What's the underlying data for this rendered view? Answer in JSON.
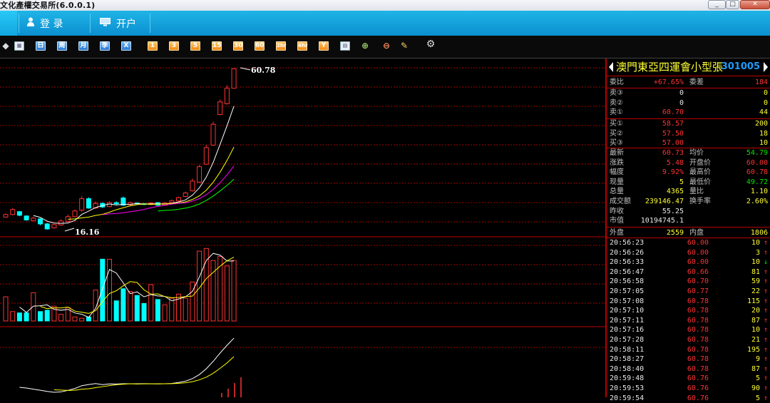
{
  "window": {
    "title": "文化產權交易所(6.0.0.1)",
    "min": "_",
    "max": "□",
    "close": "✕"
  },
  "menu": {
    "login": "登 录",
    "open_account": "开户"
  },
  "toolbar": {
    "period_buttons": [
      "日",
      "周",
      "月",
      "季",
      "X"
    ],
    "minute_buttons": [
      "1",
      "3",
      "5",
      "15",
      "30",
      "60",
      "2hr",
      "4hr",
      "Y"
    ],
    "icons": [
      "chart-type-icon",
      "calendar-icon",
      "draw-icon",
      "zoom-in-icon",
      "zoom-out-icon",
      "edit-icon",
      "gear-icon"
    ]
  },
  "chart": {
    "price_high_label": "60.78",
    "price_low_label": "16.16",
    "colors": {
      "up": "#ff3232",
      "down": "#00ffff",
      "ma5": "#ffffff",
      "ma10": "#ffff00",
      "ma20": "#ff00ff",
      "ma60": "#00ff00",
      "grid": "#a00000"
    }
  },
  "chart_data": {
    "type": "candlestick",
    "candles": [
      [
        19.5,
        20.2,
        20.5,
        19.3
      ],
      [
        20.2,
        21.6,
        22.0,
        20.0
      ],
      [
        21.0,
        20.0,
        21.2,
        19.7
      ],
      [
        19.8,
        18.7,
        20.0,
        18.5
      ],
      [
        18.5,
        19.2,
        19.6,
        18.3
      ],
      [
        19.0,
        17.6,
        19.2,
        17.2
      ],
      [
        17.6,
        16.2,
        17.9,
        16.0
      ],
      [
        16.5,
        17.4,
        17.6,
        16.3
      ],
      [
        17.3,
        18.4,
        18.9,
        17.1
      ],
      [
        18.3,
        19.6,
        20.2,
        18.0
      ],
      [
        19.6,
        21.2,
        21.6,
        19.4
      ],
      [
        21.4,
        24.6,
        25.3,
        21.0
      ],
      [
        24.6,
        22.0,
        25.0,
        21.8
      ],
      [
        22.0,
        23.3,
        23.8,
        21.8
      ],
      [
        23.3,
        22.3,
        23.6,
        22.0
      ],
      [
        22.4,
        23.5,
        23.9,
        22.2
      ],
      [
        23.5,
        23.2,
        23.9,
        22.9
      ],
      [
        24.8,
        22.8,
        25.2,
        22.6
      ],
      [
        22.9,
        23.5,
        23.8,
        22.7
      ],
      [
        23.4,
        23.2,
        23.6,
        22.9
      ],
      [
        23.2,
        23.0,
        23.4,
        22.8
      ],
      [
        23.0,
        23.4,
        23.6,
        22.8
      ],
      [
        23.5,
        22.8,
        23.7,
        22.6
      ],
      [
        22.8,
        23.4,
        23.7,
        22.6
      ],
      [
        23.5,
        24.0,
        24.4,
        23.3
      ],
      [
        24.0,
        24.9,
        25.2,
        23.8
      ],
      [
        25.2,
        26.2,
        26.6,
        25.0
      ],
      [
        26.8,
        29.5,
        30.2,
        26.6
      ],
      [
        29.2,
        33.5,
        34.0,
        29.0
      ],
      [
        34.2,
        38.8,
        39.5,
        34.0
      ],
      [
        39.5,
        45.3,
        46.0,
        39.3
      ],
      [
        48.0,
        51.5,
        52.2,
        47.8
      ],
      [
        51.0,
        55.3,
        56.2,
        50.8
      ],
      [
        55.3,
        60.73,
        60.78,
        55.3
      ]
    ],
    "volume": [
      18,
      7,
      6,
      6,
      21,
      7,
      8,
      11,
      5,
      10,
      3,
      2,
      3,
      23,
      46,
      46,
      15,
      24,
      22,
      19,
      13,
      27,
      16,
      12,
      17,
      20,
      17,
      29,
      52,
      54,
      45,
      48,
      41,
      45
    ],
    "volume_ma": [
      {
        "name": "MA5",
        "color": "#ffffff"
      },
      {
        "name": "MA10",
        "color": "#ffff00"
      }
    ],
    "indicator_lines": [
      {
        "color": "#ffffff"
      },
      {
        "color": "#ffff00"
      }
    ]
  },
  "quote": {
    "name": "澳門東亞四運會小型張",
    "code": "301005",
    "weibi_label": "委比",
    "weibi_value": "+67.65%",
    "weicha_label": "委差",
    "weicha_value": "184",
    "sell": [
      {
        "label": "卖③",
        "price": "0",
        "vol": "0"
      },
      {
        "label": "卖②",
        "price": "0",
        "vol": "0"
      },
      {
        "label": "卖①",
        "price": "60.70",
        "vol": "44"
      }
    ],
    "buy": [
      {
        "label": "买①",
        "price": "58.57",
        "vol": "200"
      },
      {
        "label": "买②",
        "price": "57.50",
        "vol": "18"
      },
      {
        "label": "买③",
        "price": "57.00",
        "vol": "10"
      }
    ],
    "stats": [
      {
        "l1": "最新",
        "v1": "60.73",
        "l2": "均价",
        "v2": "54.79"
      },
      {
        "l1": "涨跌",
        "v1": "5.48",
        "l2": "开盘价",
        "v2": "60.00"
      },
      {
        "l1": "幅度",
        "v1": "9.92%",
        "l2": "最高价",
        "v2": "60.78"
      },
      {
        "l1": "现量",
        "v1": "5",
        "l2": "最低价",
        "v2": "49.72"
      },
      {
        "l1": "总量",
        "v1": "4365",
        "l2": "量比",
        "v2": "1.10"
      },
      {
        "l1": "成交额",
        "v1": "239146.47",
        "l2": "换手率",
        "v2": "2.60%"
      },
      {
        "l1": "昨收",
        "v1": "55.25",
        "l2": "",
        "v2": ""
      },
      {
        "l1": "市值",
        "v1": "10194745.1",
        "l2": "",
        "v2": ""
      }
    ],
    "outer_label": "外盘",
    "outer_value": "2559",
    "inner_label": "内盘",
    "inner_value": "1806",
    "ticks": [
      {
        "time": "20:56:23",
        "price": "60.00",
        "vol": "10",
        "dir": "↑"
      },
      {
        "time": "20:56:26",
        "price": "60.00",
        "vol": "3",
        "dir": "↑"
      },
      {
        "time": "20:56:33",
        "price": "60.00",
        "vol": "10",
        "dir": "↓"
      },
      {
        "time": "20:56:47",
        "price": "60.66",
        "vol": "81",
        "dir": "↑"
      },
      {
        "time": "20:56:58",
        "price": "60.70",
        "vol": "59",
        "dir": "↑"
      },
      {
        "time": "20:57:05",
        "price": "60.77",
        "vol": "22",
        "dir": "↑"
      },
      {
        "time": "20:57:08",
        "price": "60.78",
        "vol": "115",
        "dir": "↑"
      },
      {
        "time": "20:57:10",
        "price": "60.78",
        "vol": "20",
        "dir": "↑"
      },
      {
        "time": "20:57:11",
        "price": "60.78",
        "vol": "87",
        "dir": "↑"
      },
      {
        "time": "20:57:16",
        "price": "60.78",
        "vol": "10",
        "dir": "↑"
      },
      {
        "time": "20:57:28",
        "price": "60.78",
        "vol": "21",
        "dir": "↑"
      },
      {
        "time": "20:58:11",
        "price": "60.78",
        "vol": "195",
        "dir": "↑"
      },
      {
        "time": "20:58:27",
        "price": "60.78",
        "vol": "9",
        "dir": "↑"
      },
      {
        "time": "20:58:40",
        "price": "60.78",
        "vol": "87",
        "dir": "↑"
      },
      {
        "time": "20:59:48",
        "price": "60.76",
        "vol": "5",
        "dir": "↑"
      },
      {
        "time": "20:59:53",
        "price": "60.76",
        "vol": "90",
        "dir": "↑"
      },
      {
        "time": "20:59:54",
        "price": "60.76",
        "vol": "5",
        "dir": "↑"
      }
    ]
  }
}
